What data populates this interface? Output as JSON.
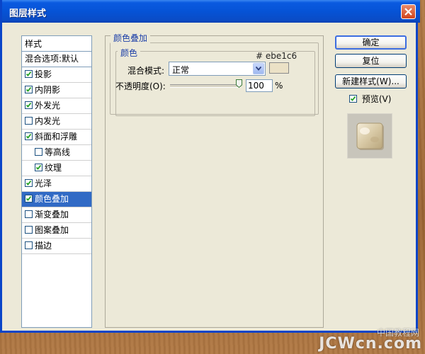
{
  "window": {
    "title": "图层样式",
    "close_icon": "close-icon"
  },
  "styles_list": {
    "header": "样式",
    "blend_options": "混合选项:默认",
    "items": [
      {
        "label": "投影",
        "checked": true,
        "indent": false,
        "selected": false
      },
      {
        "label": "内阴影",
        "checked": true,
        "indent": false,
        "selected": false
      },
      {
        "label": "外发光",
        "checked": true,
        "indent": false,
        "selected": false
      },
      {
        "label": "内发光",
        "checked": false,
        "indent": false,
        "selected": false
      },
      {
        "label": "斜面和浮雕",
        "checked": true,
        "indent": false,
        "selected": false
      },
      {
        "label": "等高线",
        "checked": false,
        "indent": true,
        "selected": false
      },
      {
        "label": "纹理",
        "checked": true,
        "indent": true,
        "selected": false
      },
      {
        "label": "光泽",
        "checked": true,
        "indent": false,
        "selected": false
      },
      {
        "label": "颜色叠加",
        "checked": true,
        "indent": false,
        "selected": true
      },
      {
        "label": "渐变叠加",
        "checked": false,
        "indent": false,
        "selected": false
      },
      {
        "label": "图案叠加",
        "checked": false,
        "indent": false,
        "selected": false
      },
      {
        "label": "描边",
        "checked": false,
        "indent": false,
        "selected": false
      }
    ]
  },
  "panel": {
    "group_title": "颜色叠加",
    "sub_group_title": "颜色",
    "hex_value": "# ebe1c6",
    "color": "#ebe1c6",
    "blend_mode_label": "混合模式:",
    "blend_mode_value": "正常",
    "opacity_label": "不透明度(O):",
    "opacity_value": "100",
    "opacity_unit": "%",
    "opacity_fraction": 1.0
  },
  "buttons": {
    "ok": "确定",
    "reset": "复位",
    "new_style": "新建样式(W)...",
    "preview_label": "预览(V)",
    "preview_checked": true
  },
  "watermark": {
    "main": "JCWcn.com",
    "sub": "中国教程网"
  },
  "colors": {
    "title_bar": "#0653d6",
    "selection": "#316ac5",
    "dialog_bg": "#ece9d8",
    "group_title": "#1c3fa8"
  }
}
